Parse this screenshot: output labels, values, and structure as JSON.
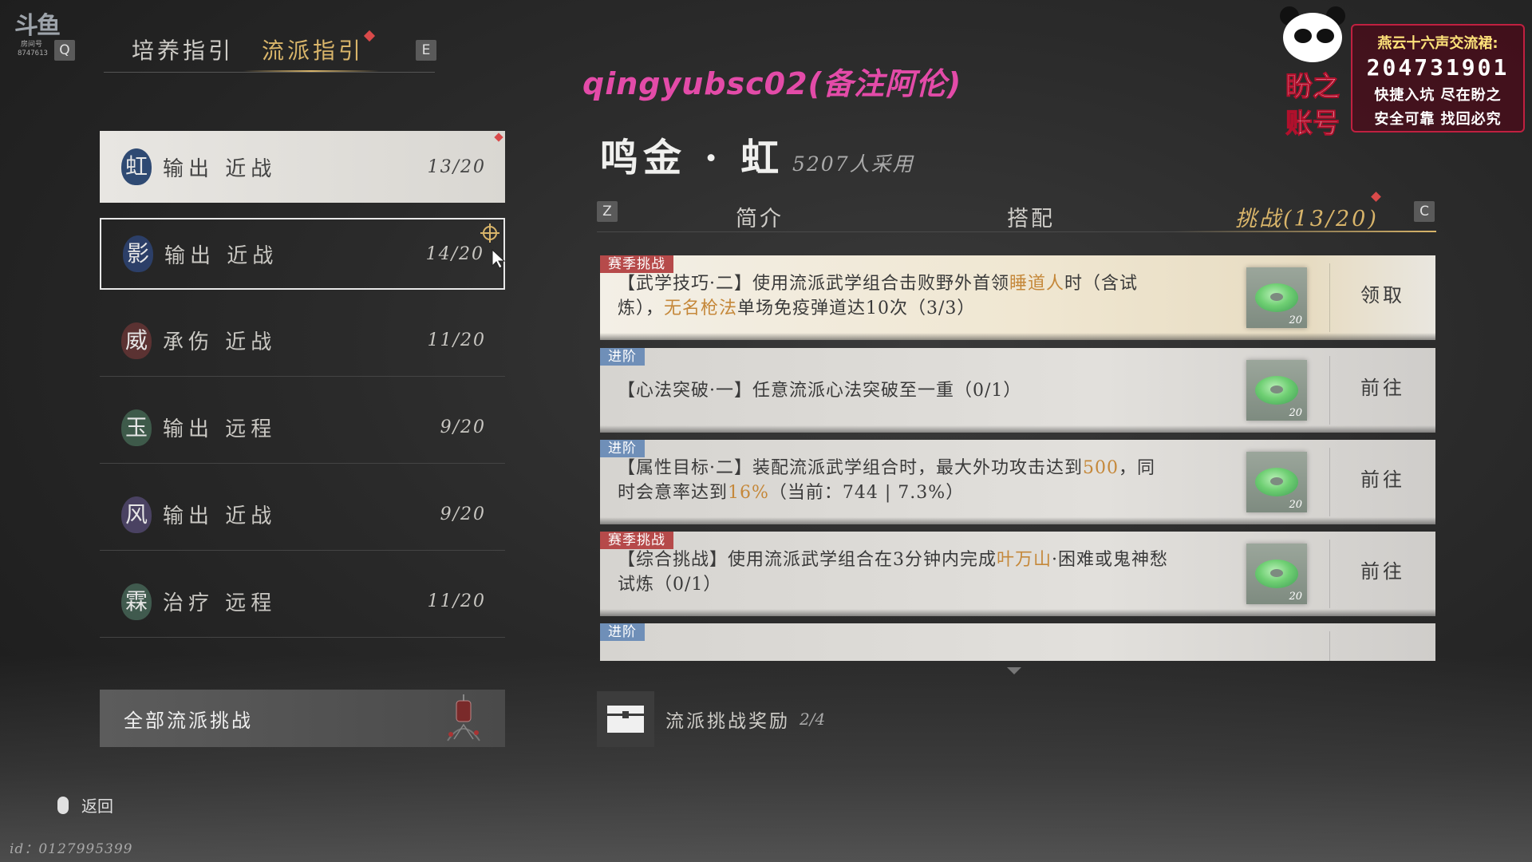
{
  "logo": {
    "mark": "斗鱼",
    "tag": "房间号",
    "room_number": "8747613"
  },
  "keys": {
    "prev_tab": "Q",
    "next_tab": "E",
    "prev_sub": "Z",
    "next_sub": "C"
  },
  "top_tabs": [
    {
      "label": "培养指引",
      "active": false
    },
    {
      "label": "流派指引",
      "active": true
    }
  ],
  "schools": [
    {
      "seal": "虹",
      "label": "输出 近战",
      "count": "13/20",
      "seal_color": "#2f4a73"
    },
    {
      "seal": "影",
      "label": "输出 近战",
      "count": "14/20",
      "seal_color": "#2c3f68"
    },
    {
      "seal": "威",
      "label": "承伤 近战",
      "count": "11/20",
      "seal_color": "#5b3232"
    },
    {
      "seal": "玉",
      "label": "输出 远程",
      "count": "9/20",
      "seal_color": "#3e5a4a"
    },
    {
      "seal": "风",
      "label": "输出 近战",
      "count": "9/20",
      "seal_color": "#4a4262"
    },
    {
      "seal": "霖",
      "label": "治疗 远程",
      "count": "11/20",
      "seal_color": "#405a4e"
    }
  ],
  "all_challenges_label": "全部流派挑战",
  "back_label": "返回",
  "uid": "id：0127995399",
  "watermark": "qingyubsc02(备注阿伦)",
  "school_title": "鸣金 · 虹",
  "users_count": "5207人采用",
  "sub_tabs": [
    {
      "label": "简介",
      "active": false
    },
    {
      "label": "搭配",
      "active": false
    },
    {
      "label": "挑战(13/20)",
      "active": true
    }
  ],
  "quests": [
    {
      "badge": "赛季挑战",
      "badge_type": "season",
      "style": "gold",
      "desc_parts": [
        {
          "text": "【武学技巧·二】使用流派武学组合击败野外首领",
          "hl": false
        },
        {
          "text": "睡道人",
          "hl": true
        },
        {
          "text": "时（含试炼），",
          "hl": false
        },
        {
          "text": "无名枪法",
          "hl": true
        },
        {
          "text": "单场免疫弹道达10次（3/3）",
          "hl": false
        }
      ],
      "reward_qty": "20",
      "action": "领取"
    },
    {
      "badge": "进阶",
      "badge_type": "advance",
      "style": "single",
      "desc_parts": [
        {
          "text": "【心法突破·一】任意流派心法突破至一重（0/1）",
          "hl": false
        }
      ],
      "reward_qty": "20",
      "action": "前往"
    },
    {
      "badge": "进阶",
      "badge_type": "advance",
      "style": "normal",
      "desc_parts": [
        {
          "text": "【属性目标·二】装配流派武学组合时，最大外功攻击达到",
          "hl": false
        },
        {
          "text": "500",
          "hl": true
        },
        {
          "text": "，同时会意率达到",
          "hl": false
        },
        {
          "text": "16%",
          "hl": true
        },
        {
          "text": "（当前：744 | 7.3%）",
          "hl": false
        }
      ],
      "reward_qty": "20",
      "action": "前往"
    },
    {
      "badge": "赛季挑战",
      "badge_type": "season",
      "style": "normal",
      "desc_parts": [
        {
          "text": "【综合挑战】使用流派武学组合在3分钟内完成",
          "hl": false
        },
        {
          "text": "叶万山",
          "hl": true
        },
        {
          "text": "·困难或鬼神愁试炼（0/1）",
          "hl": false
        }
      ],
      "reward_qty": "20",
      "action": "前往"
    },
    {
      "badge": "进阶",
      "badge_type": "advance",
      "style": "normal",
      "desc_parts": [],
      "reward_qty": "",
      "action": ""
    }
  ],
  "reward_bar": {
    "label": "流派挑战奖励",
    "progress": "2/4"
  },
  "promo": {
    "name": "盼之账号",
    "line1": "燕云十六声交流裙:",
    "number": "204731901",
    "line3": "快捷入坑 尽在盼之",
    "line4": "安全可靠 找回必究"
  },
  "colors": {
    "accent_gold": "#d9b56a",
    "highlight_orange": "#c5883a",
    "season_badge": "#b64a4a",
    "advance_badge": "#6f8fb8",
    "watermark_pink": "#e34ba8"
  }
}
